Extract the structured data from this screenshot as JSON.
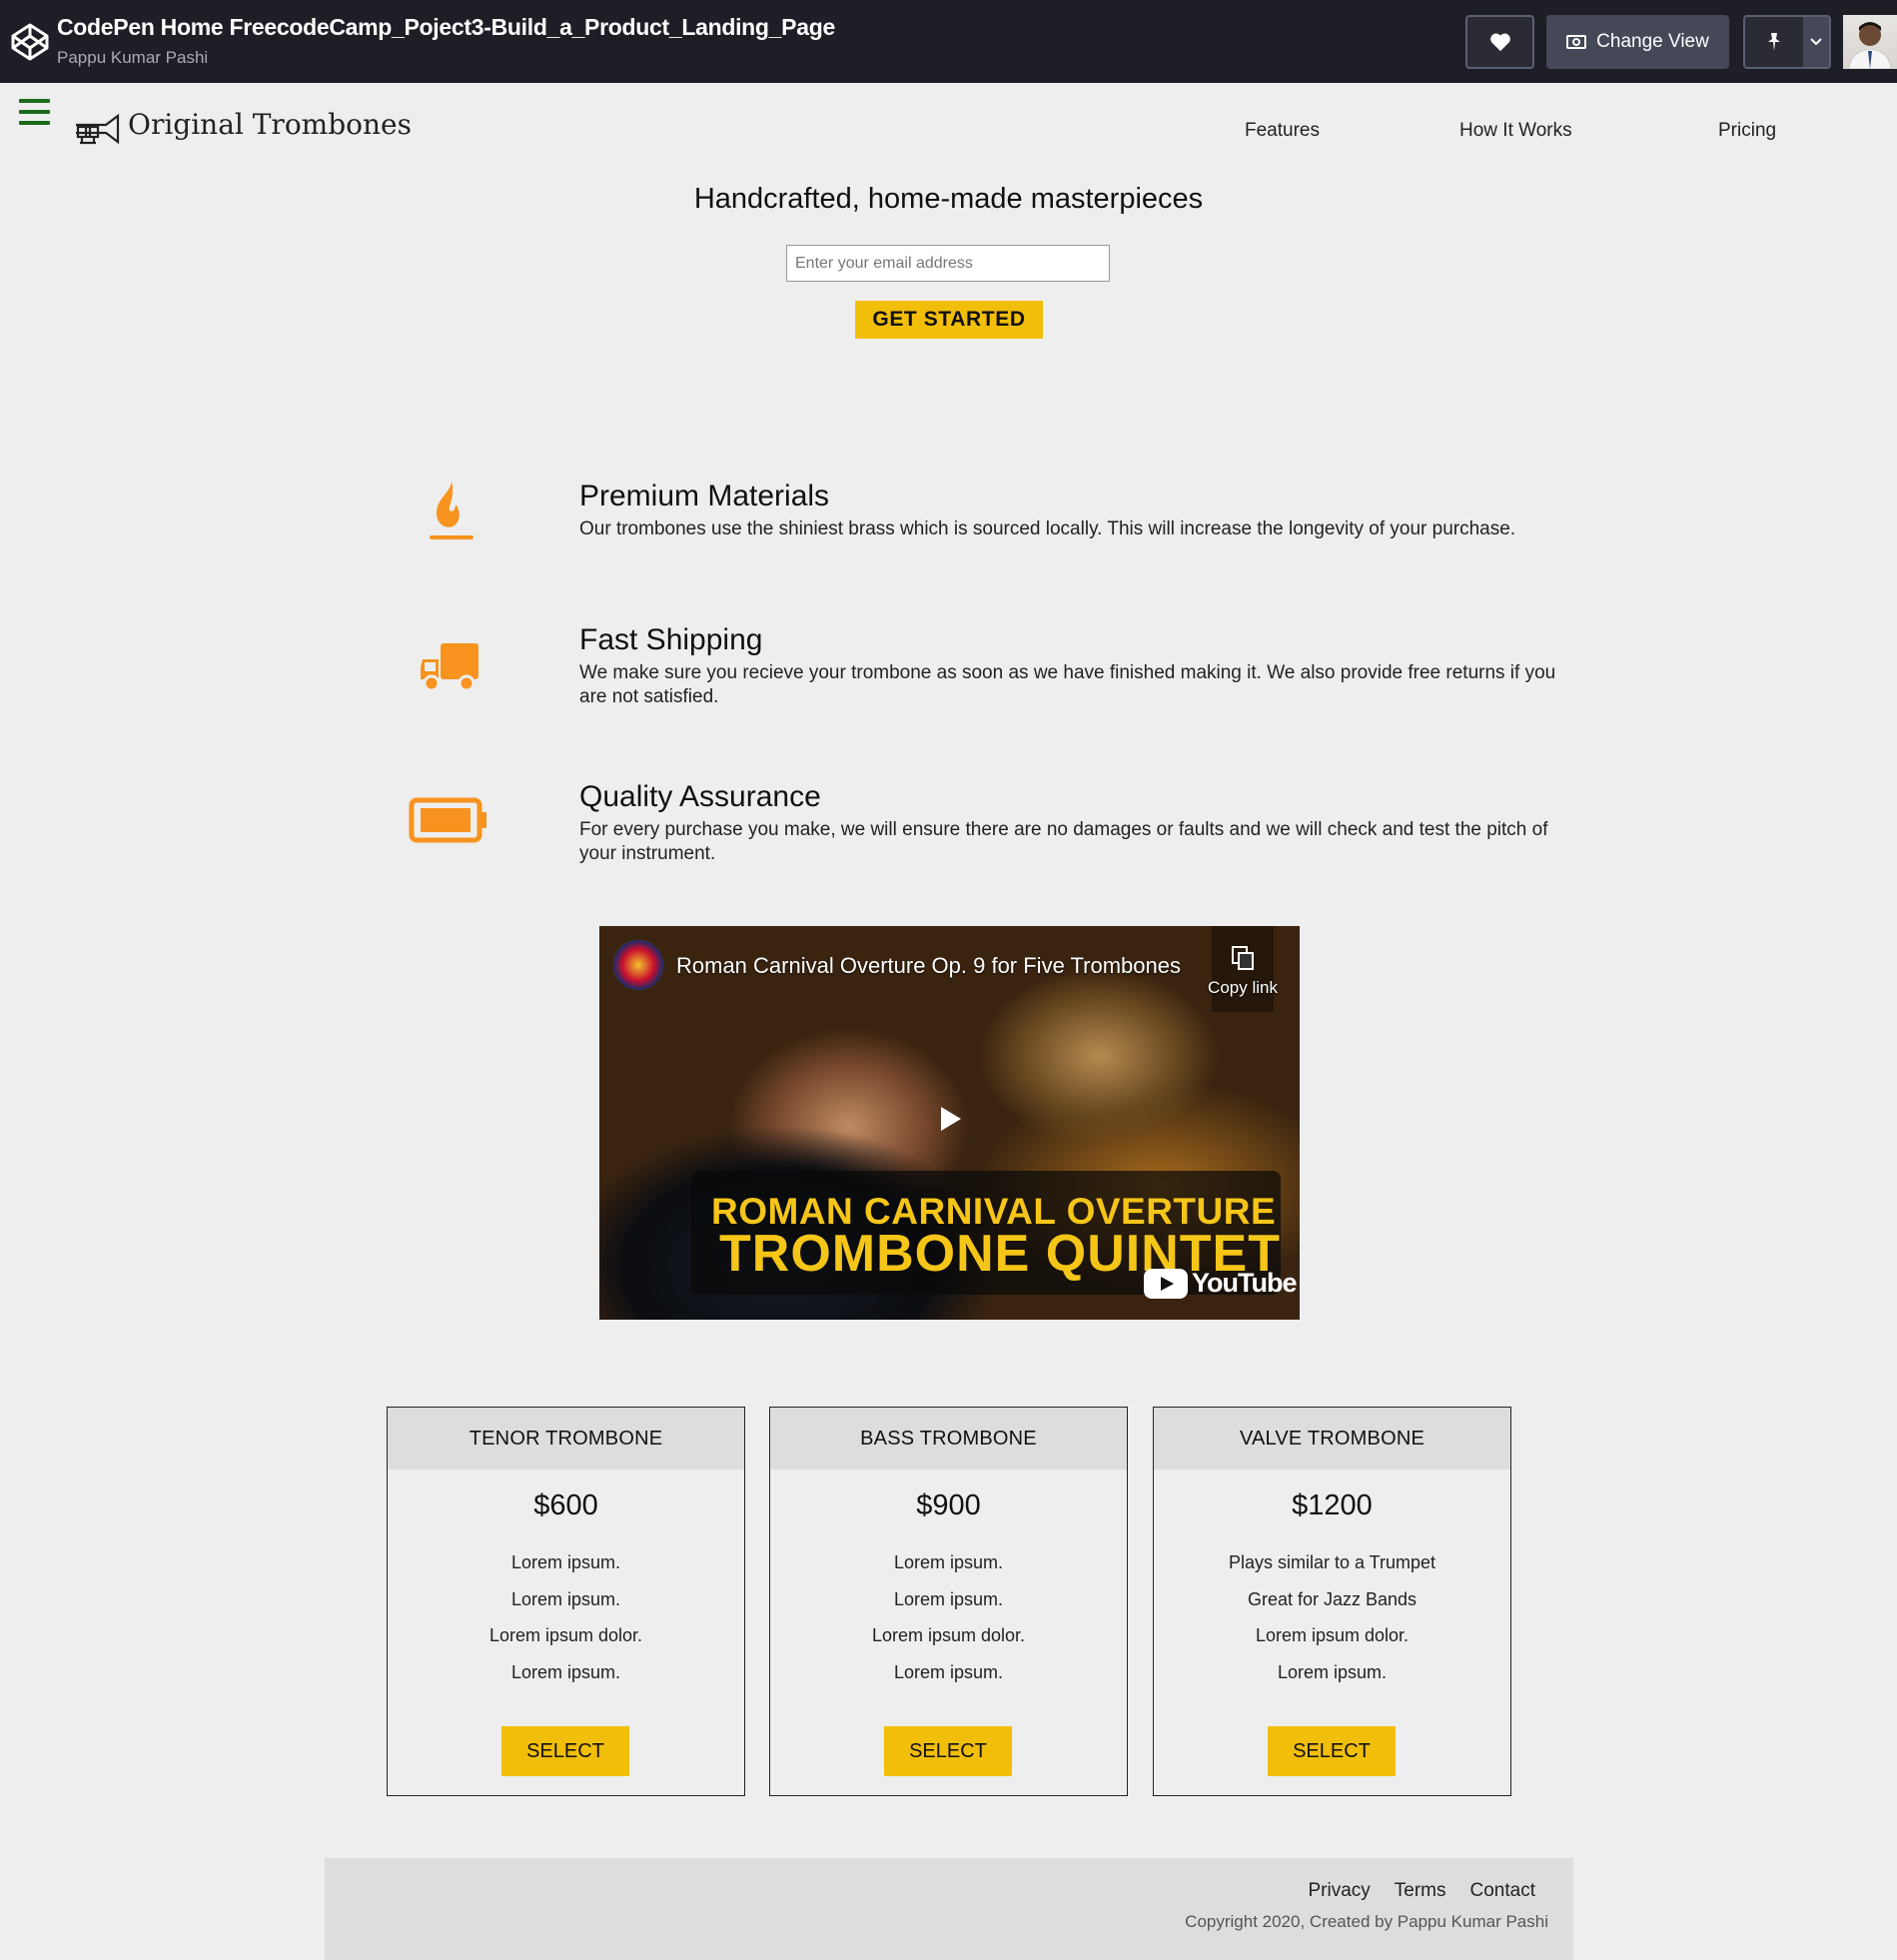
{
  "codepen": {
    "title": "CodePen Home FreecodeCamp_Poject3-Build_a_Product_Landing_Page",
    "author": "Pappu Kumar Pashi",
    "change_view_label": "Change View"
  },
  "site": {
    "brand": "Original Trombones",
    "nav": [
      "Features",
      "How It Works",
      "Pricing"
    ]
  },
  "hero": {
    "title": "Handcrafted, home-made masterpieces",
    "email_placeholder": "Enter your email address",
    "cta": "GET STARTED"
  },
  "features": [
    {
      "icon": "fire-icon",
      "title": "Premium Materials",
      "text": "Our trombones use the shiniest brass which is sourced locally. This will increase the longevity of your purchase."
    },
    {
      "icon": "truck-icon",
      "title": "Fast Shipping",
      "text": "We make sure you recieve your trombone as soon as we have finished making it. We also provide free returns if you are not satisfied."
    },
    {
      "icon": "battery-full-icon",
      "title": "Quality Assurance",
      "text": "For every purchase you make, we will ensure there are no damages or faults and we will check and test the pitch of your instrument."
    }
  ],
  "video": {
    "title": "Roman Carnival Overture Op. 9 for Five Trombones",
    "copy_link": "Copy link",
    "banner_line1": "ROMAN CARNIVAL OVERTURE",
    "banner_line2": "TROMBONE QUINTET",
    "brand": "YouTube"
  },
  "pricing": [
    {
      "name": "TENOR TROMBONE",
      "price": "$600",
      "features": [
        "Lorem ipsum.",
        "Lorem ipsum.",
        "Lorem ipsum dolor.",
        "Lorem ipsum."
      ],
      "button": "SELECT"
    },
    {
      "name": "BASS TROMBONE",
      "price": "$900",
      "features": [
        "Lorem ipsum.",
        "Lorem ipsum.",
        "Lorem ipsum dolor.",
        "Lorem ipsum."
      ],
      "button": "SELECT"
    },
    {
      "name": "VALVE TROMBONE",
      "price": "$1200",
      "features": [
        "Plays similar to a Trumpet",
        "Great for Jazz Bands",
        "Lorem ipsum dolor.",
        "Lorem ipsum."
      ],
      "button": "SELECT"
    }
  ],
  "footer": {
    "links": [
      "Privacy",
      "Terms",
      "Contact"
    ],
    "copyright": "Copyright 2020, Created by Pappu Kumar Pashi"
  },
  "colors": {
    "accent": "#f1be0a",
    "icon_orange": "#f7931e",
    "codepen_bar": "#1e1f26",
    "hamburger": "#1c6b1c"
  }
}
